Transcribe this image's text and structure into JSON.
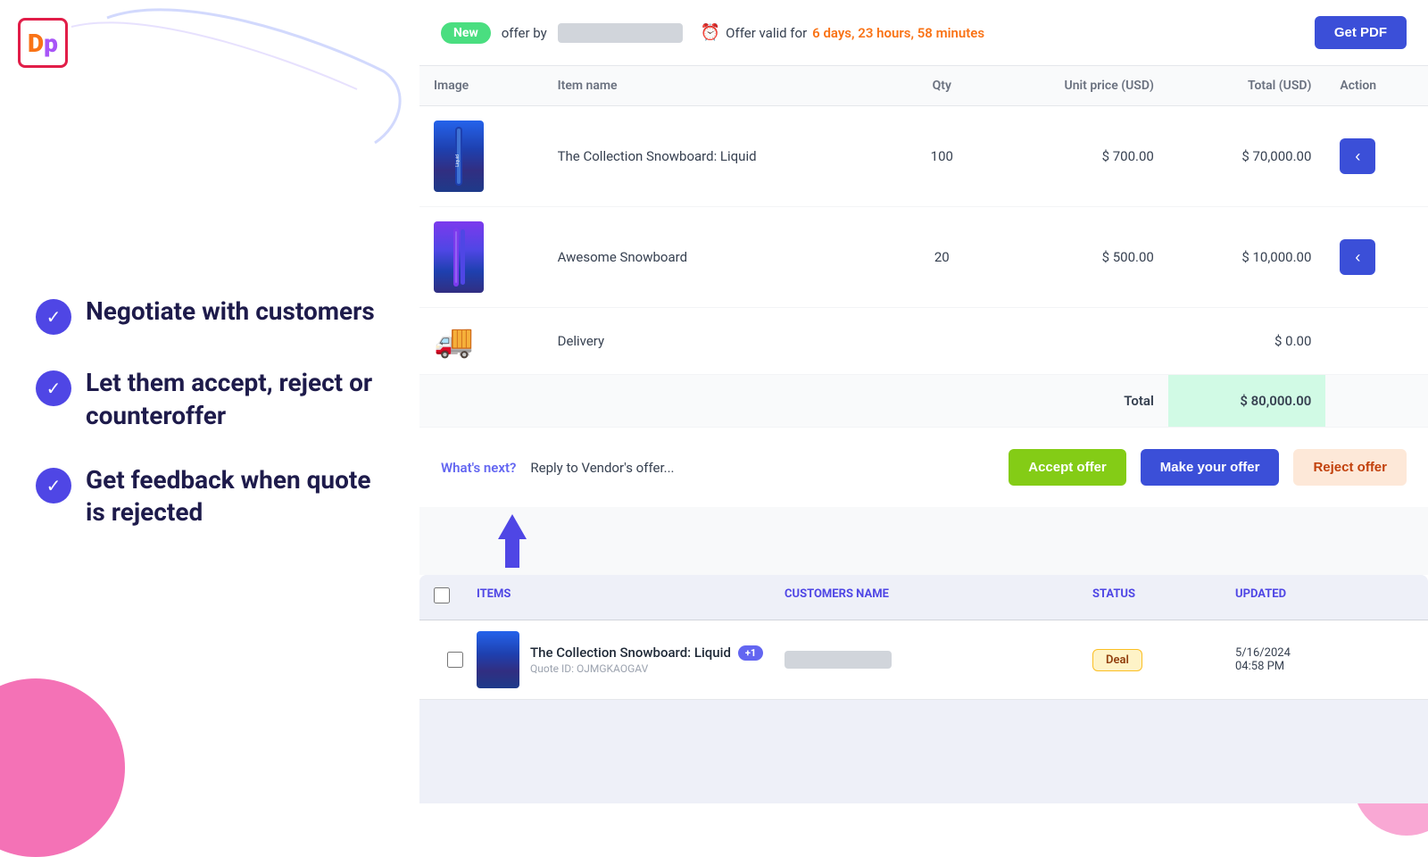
{
  "logo": {
    "d": "D",
    "p": "p"
  },
  "features": [
    {
      "id": "negotiate",
      "text": "Negotiate with customers"
    },
    {
      "id": "accept-reject",
      "text": "Let them accept, reject or counteroffer"
    },
    {
      "id": "feedback",
      "text": "Get feedback when quote is rejected"
    }
  ],
  "offer_header": {
    "badge": "New",
    "offer_by_label": "offer by",
    "timer_icon": "⏰",
    "timer_prefix": "Offer valid for",
    "timer_value": "6 days, 23 hours, 58 minutes",
    "get_pdf_label": "Get PDF"
  },
  "table": {
    "headers": [
      "Image",
      "Item name",
      "Qty",
      "Unit price (USD)",
      "Total (USD)",
      "Action"
    ],
    "rows": [
      {
        "id": "row-liquid",
        "item_name": "The Collection Snowboard: Liquid",
        "qty": "100",
        "unit_price": "$ 700.00",
        "total": "$ 70,000.00",
        "img_type": "snowboard"
      },
      {
        "id": "row-awesome",
        "item_name": "Awesome Snowboard",
        "qty": "20",
        "unit_price": "$ 500.00",
        "total": "$ 10,000.00",
        "img_type": "awesome"
      },
      {
        "id": "row-delivery",
        "item_name": "Delivery",
        "qty": "",
        "unit_price": "",
        "total": "$ 0.00",
        "img_type": "delivery"
      }
    ],
    "total_label": "Total",
    "total_value": "$ 80,000.00"
  },
  "whats_next": {
    "label": "What's next?",
    "text": "Reply to Vendor's offer...",
    "accept_label": "Accept offer",
    "make_label": "Make your offer",
    "reject_label": "Reject offer"
  },
  "quotes_list": {
    "headers": [
      "",
      "ITEMS",
      "CUSTOMERS NAME",
      "STATUS",
      "UPDATED"
    ],
    "rows": [
      {
        "product_name": "The Collection Snowboard: Liquid",
        "badge_count": "+1",
        "quote_id": "Quote ID: OJMGKAOGAV",
        "status": "Deal",
        "updated": "5/16/2024",
        "updated_time": "04:58 PM"
      }
    ]
  }
}
